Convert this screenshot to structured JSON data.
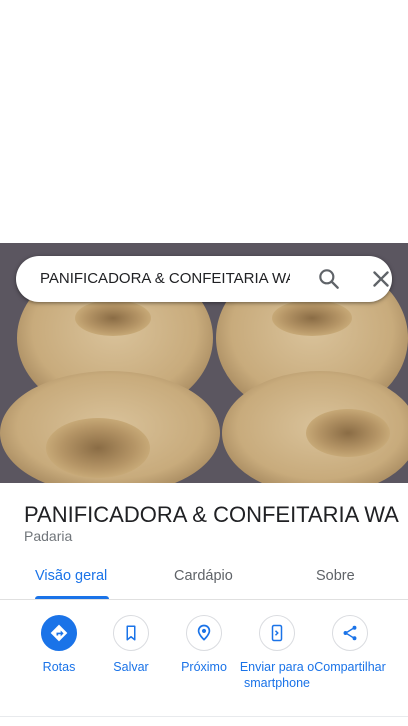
{
  "search": {
    "query": "PANIFICADORA & CONFEITARIA WA",
    "search_icon": "search-icon",
    "close_icon": "close-icon"
  },
  "place": {
    "title": "PANIFICADORA & CONFEITARIA WA",
    "category": "Padaria"
  },
  "photo": {
    "subject": "ring-cakes-photo"
  },
  "tabs": [
    {
      "label": "Visão geral",
      "active": true
    },
    {
      "label": "Cardápio",
      "active": false
    },
    {
      "label": "Sobre",
      "active": false
    }
  ],
  "actions": [
    {
      "label": "Rotas",
      "icon": "directions-icon"
    },
    {
      "label": "Salvar",
      "icon": "bookmark-icon"
    },
    {
      "label": "Próximo",
      "icon": "nearby-icon"
    },
    {
      "label": "Enviar para o smartphone",
      "icon": "send-to-phone-icon"
    },
    {
      "label": "Compartilhar",
      "icon": "share-icon"
    }
  ],
  "colors": {
    "accent": "#1a73e8",
    "text": "#202124",
    "secondary": "#70757a",
    "tab_inactive": "#5f6368"
  }
}
